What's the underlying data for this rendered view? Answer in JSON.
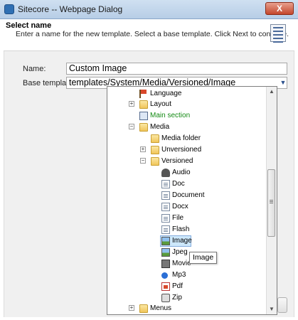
{
  "window": {
    "title": "Sitecore -- Webpage Dialog",
    "close_label": "X"
  },
  "header": {
    "title": "Select name",
    "description": "Enter a name for the new template. Select a base template. Click Next to continue."
  },
  "form": {
    "name_label": "Name:",
    "name_value": "Custom Image",
    "base_label": "Base template:",
    "base_value": "templates/System/Media/Versioned/Image"
  },
  "tree": {
    "items": [
      {
        "label": "Language",
        "icon": "flag-icon",
        "toggle": ""
      },
      {
        "label": "Layout",
        "icon": "folder-icon",
        "toggle": "+"
      },
      {
        "label": "Main section",
        "icon": "form-icon",
        "toggle": "",
        "color": "#138a13"
      },
      {
        "label": "Media",
        "icon": "folder-icon",
        "toggle": "−"
      },
      {
        "label": "Media folder",
        "icon": "folder-icon",
        "toggle": ""
      },
      {
        "label": "Unversioned",
        "icon": "folder-icon",
        "toggle": "+"
      },
      {
        "label": "Versioned",
        "icon": "folder-icon",
        "toggle": "−"
      },
      {
        "label": "Audio",
        "icon": "speaker-icon",
        "toggle": ""
      },
      {
        "label": "Doc",
        "icon": "document-icon",
        "toggle": ""
      },
      {
        "label": "Document",
        "icon": "document-icon",
        "toggle": ""
      },
      {
        "label": "Docx",
        "icon": "document-icon",
        "toggle": ""
      },
      {
        "label": "File",
        "icon": "document-icon",
        "toggle": ""
      },
      {
        "label": "Flash",
        "icon": "document-icon",
        "toggle": ""
      },
      {
        "label": "Image",
        "icon": "image-icon",
        "toggle": "",
        "selected": true
      },
      {
        "label": "Jpeg",
        "icon": "image-icon",
        "toggle": ""
      },
      {
        "label": "Movie",
        "icon": "film-icon",
        "toggle": ""
      },
      {
        "label": "Mp3",
        "icon": "music-note-icon",
        "toggle": ""
      },
      {
        "label": "Pdf",
        "icon": "pdf-icon",
        "toggle": ""
      },
      {
        "label": "Zip",
        "icon": "zip-icon",
        "toggle": ""
      },
      {
        "label": "Menus",
        "icon": "folder-icon",
        "toggle": "+"
      }
    ]
  },
  "tooltip": "Image"
}
